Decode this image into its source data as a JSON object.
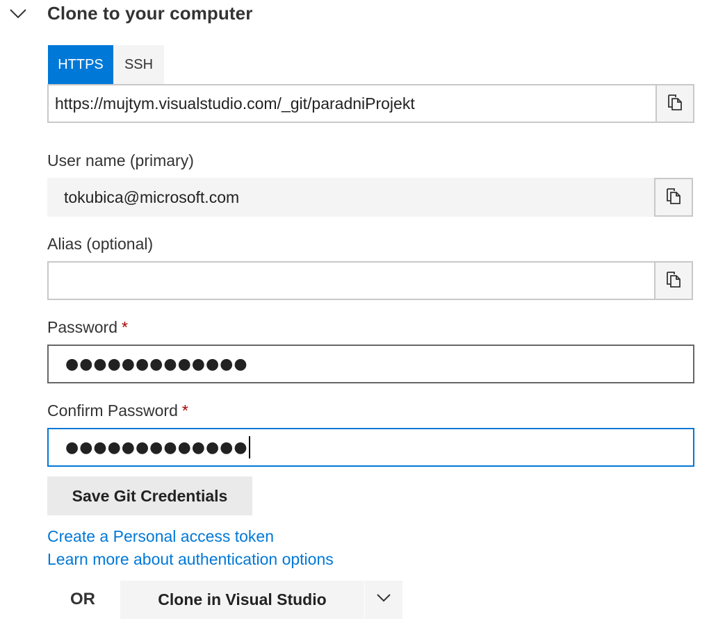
{
  "section": {
    "title": "Clone to your computer",
    "chevron_icon": "chevron-down-icon"
  },
  "protocol_tabs": [
    {
      "label": "HTTPS",
      "active": true
    },
    {
      "label": "SSH",
      "active": false
    }
  ],
  "clone_url": {
    "value": "https://mujtym.visualstudio.com/_git/paradniProjekt",
    "copy_icon": "copy-icon"
  },
  "username": {
    "label": "User name (primary)",
    "value": "tokubica@microsoft.com",
    "copy_icon": "copy-icon"
  },
  "alias": {
    "label": "Alias (optional)",
    "value": "",
    "copy_icon": "copy-icon"
  },
  "password": {
    "label": "Password",
    "required_mark": "*",
    "masked_value": "●●●●●●●●●●●●●"
  },
  "confirm_password": {
    "label": "Confirm Password",
    "required_mark": "*",
    "masked_value": "●●●●●●●●●●●●●"
  },
  "actions": {
    "save_label": "Save Git Credentials",
    "pat_link": "Create a Personal access token",
    "auth_link": "Learn more about authentication options",
    "or_label": "OR",
    "clone_vs_label": "Clone in Visual Studio",
    "dropdown_icon": "chevron-down-icon"
  },
  "colors": {
    "accent": "#0078d7",
    "required": "#a80000",
    "text": "#333333",
    "button_bg": "#f4f4f4"
  }
}
